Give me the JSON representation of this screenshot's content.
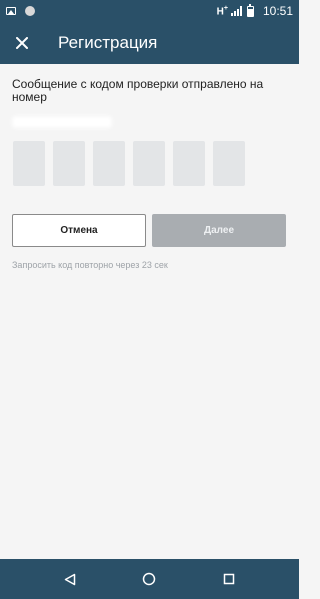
{
  "status_bar": {
    "network": "H",
    "network_plus": "+",
    "time": "10:51",
    "icons": [
      "image-icon",
      "circle-icon",
      "signal-icon",
      "battery-icon"
    ]
  },
  "app_bar": {
    "close_icon": "close-icon",
    "title": "Регистрация"
  },
  "main": {
    "message": "Сообщение с кодом проверки отправлено на номер",
    "code_digits": [
      "",
      "",
      "",
      "",
      "",
      ""
    ],
    "cancel_label": "Отмена",
    "next_label": "Далее",
    "resend_text": "Запросить код повторно через 23 сек"
  },
  "nav_bar": {
    "icons": [
      "back-icon",
      "home-icon",
      "recents-icon"
    ]
  },
  "colors": {
    "primary": "#2a5068",
    "background": "#f5f5f5",
    "code_box": "#e3e5e7",
    "disabled_button": "#a9adb1",
    "hint_text": "#9ea3a8"
  }
}
